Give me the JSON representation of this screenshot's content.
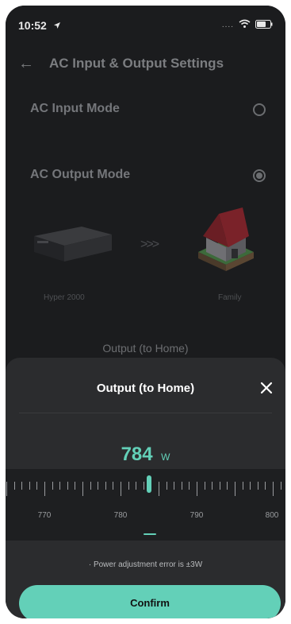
{
  "status_bar": {
    "time": "10:52",
    "signal_dots": "....",
    "icons": [
      "location-arrow-icon",
      "wifi-icon",
      "battery-icon"
    ]
  },
  "header": {
    "title": "AC Input & Output Settings"
  },
  "modes": [
    {
      "label": "AC Input Mode",
      "checked": false
    },
    {
      "label": "AC Output Mode",
      "checked": true
    }
  ],
  "diagram": {
    "device_label": "Hyper 2000",
    "target_label": "Family",
    "arrow": ">>>"
  },
  "page_output_title": "Output (to Home)",
  "sheet": {
    "title": "Output (to Home)",
    "value": "784",
    "unit": "W",
    "ruler_labels": [
      "770",
      "780",
      "790",
      "800"
    ],
    "note": "· Power adjustment error is ±3W",
    "confirm_label": "Confirm"
  },
  "colors": {
    "accent": "#63d0b8",
    "background": "#1b1c1e",
    "sheet": "#2b2c2e"
  }
}
